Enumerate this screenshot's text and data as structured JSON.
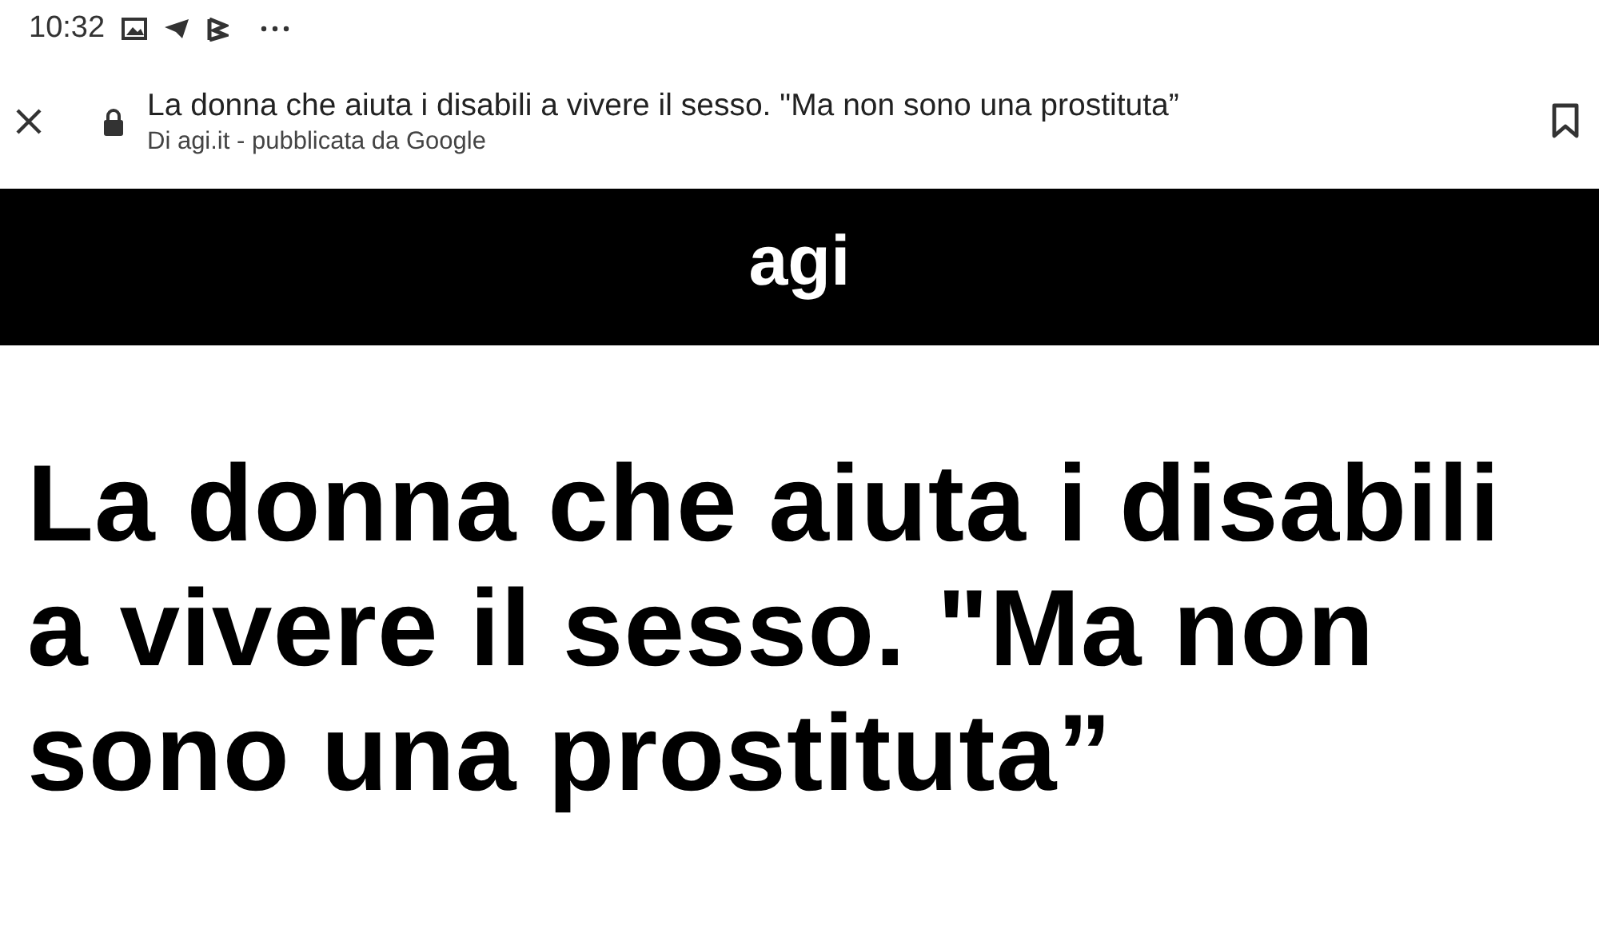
{
  "status_bar": {
    "time": "10:32"
  },
  "toolbar": {
    "title": "La donna che aiuta i disabili a vivere il sesso. \"Ma non sono una prostituta”",
    "subtitle": "Di agi.it - pubblicata da Google"
  },
  "site_header": {
    "logo": "agi"
  },
  "article": {
    "headline": "La donna che aiuta i disabili a vivere il sesso. \"Ma non sono una prostituta”"
  }
}
